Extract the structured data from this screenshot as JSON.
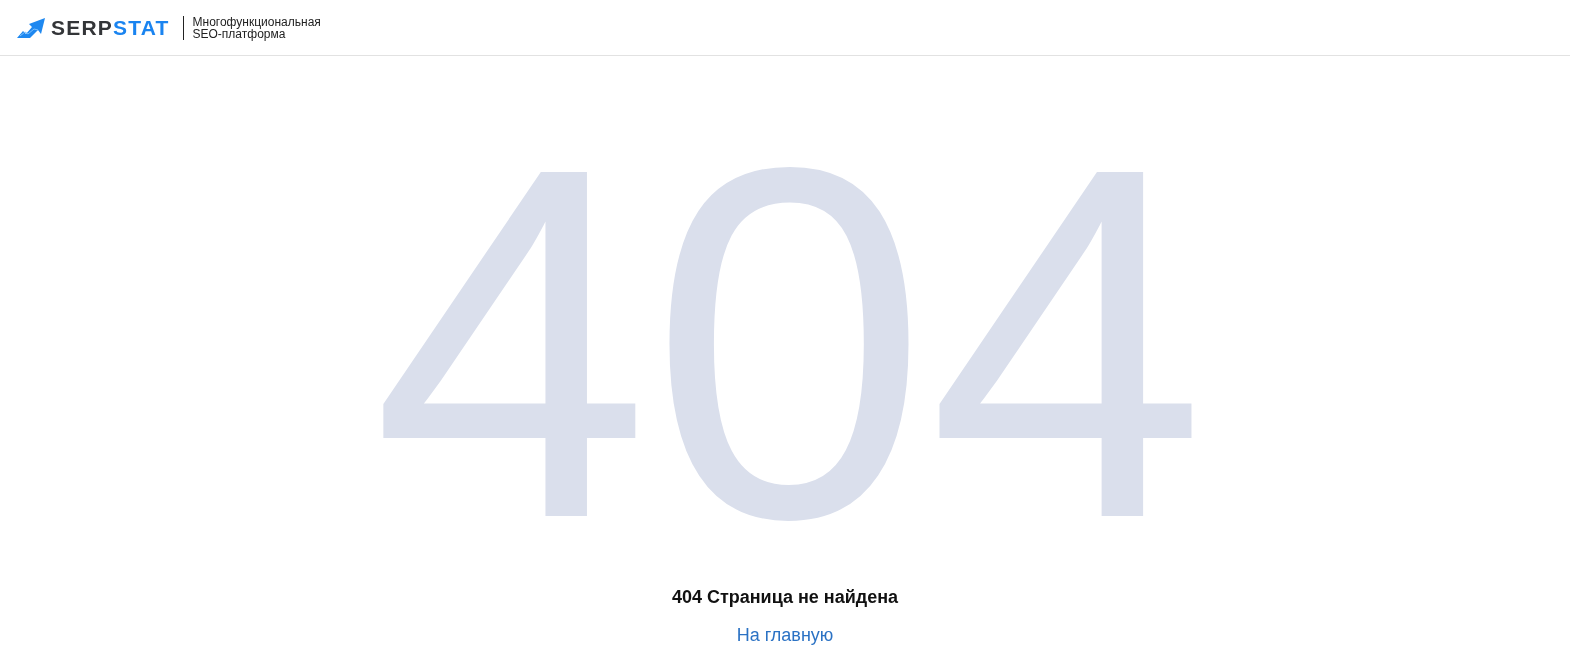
{
  "header": {
    "brand": "SERP**STAT**",
    "tagline_lines": [
      "Многофункциональная",
      "SEO-платформа"
    ]
  },
  "error": {
    "code": "404",
    "message": "404 Страница не найдена",
    "home_link": "На главную"
  }
}
